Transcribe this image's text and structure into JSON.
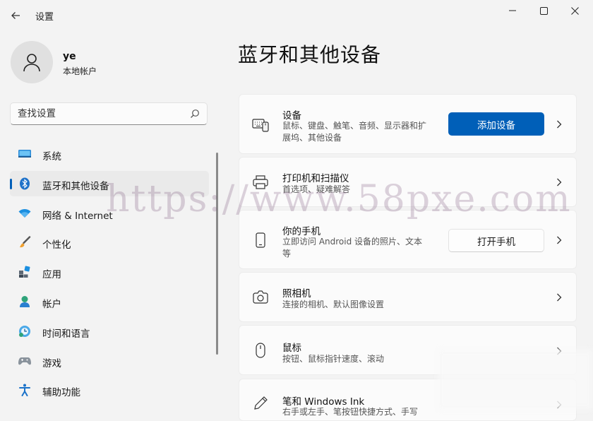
{
  "window": {
    "title": "设置"
  },
  "profile": {
    "name": "ye",
    "account_type": "本地帐户"
  },
  "search": {
    "placeholder": "查找设置"
  },
  "nav": {
    "items": [
      {
        "label": "系统",
        "icon": "system-icon"
      },
      {
        "label": "蓝牙和其他设备",
        "icon": "bluetooth-icon",
        "selected": true
      },
      {
        "label": "网络 & Internet",
        "icon": "network-icon"
      },
      {
        "label": "个性化",
        "icon": "personalization-icon"
      },
      {
        "label": "应用",
        "icon": "apps-icon"
      },
      {
        "label": "帐户",
        "icon": "accounts-icon"
      },
      {
        "label": "时间和语言",
        "icon": "time-language-icon"
      },
      {
        "label": "游戏",
        "icon": "gaming-icon"
      },
      {
        "label": "辅助功能",
        "icon": "accessibility-icon"
      }
    ]
  },
  "page": {
    "title": "蓝牙和其他设备"
  },
  "cards": [
    {
      "title": "设备",
      "desc": "鼠标、键盘、触笔、音频、显示器和扩展坞、其他设备",
      "icon": "devices-icon",
      "button": "添加设备"
    },
    {
      "title": "打印机和扫描仪",
      "desc": "首选项、疑难解答",
      "icon": "printer-icon"
    },
    {
      "title": "你的手机",
      "desc": "立即访问 Android 设备的照片、文本等",
      "icon": "phone-icon",
      "button": "打开手机"
    },
    {
      "title": "照相机",
      "desc": "连接的相机、默认图像设置",
      "icon": "camera-icon"
    },
    {
      "title": "鼠标",
      "desc": "按钮、鼠标指针速度、滚动",
      "icon": "mouse-icon"
    },
    {
      "title": "笔和 Windows Ink",
      "desc": "右手或左手、笔按钮快捷方式、手写",
      "icon": "pen-icon"
    }
  ],
  "watermark": "https://www.58pxe.com",
  "colors": {
    "accent": "#005fb8",
    "background": "#f3f3f3",
    "card": "#fbfbfb"
  }
}
